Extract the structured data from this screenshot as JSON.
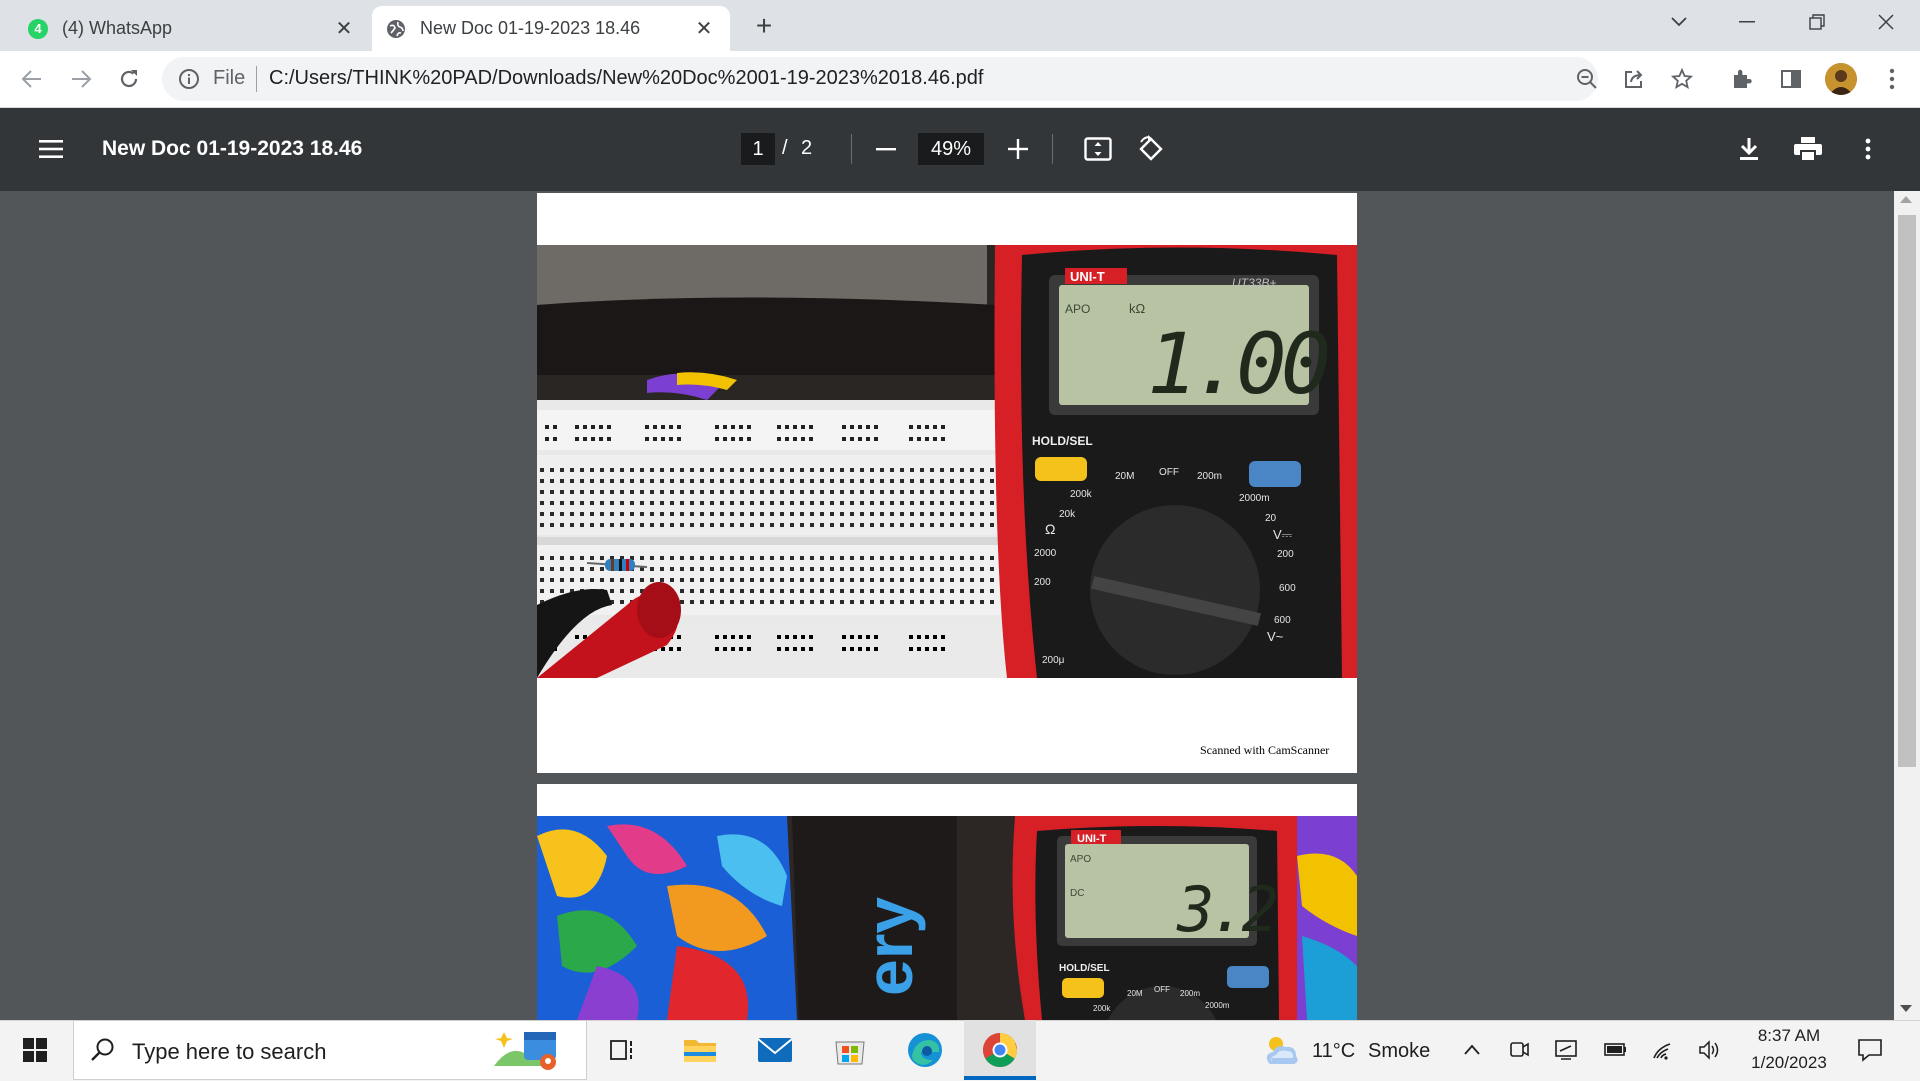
{
  "tabs": [
    {
      "title": "(4) WhatsApp",
      "badge": "4",
      "active": false
    },
    {
      "title": "New Doc 01-19-2023 18.46",
      "active": true
    }
  ],
  "address": {
    "scheme": "File",
    "url": "C:/Users/THINK%20PAD/Downloads/New%20Doc%2001-19-2023%2018.46.pdf"
  },
  "pdf": {
    "title": "New Doc 01-19-2023 18.46",
    "current_page": "1",
    "separator": "/",
    "total_pages": "2",
    "zoom": "49%"
  },
  "page1": {
    "footer": "Scanned with CamScanner",
    "meter": {
      "brand": "UNI-T",
      "model": "UT33B+",
      "apo": "APO",
      "unit": "kΩ",
      "reading": "1.00",
      "hold_label": "HOLD/SEL",
      "dial": [
        "20M",
        "OFF",
        "200m",
        "200k",
        "2000m",
        "20k",
        "20",
        "Ω",
        "V⎓",
        "2000",
        "200",
        "200",
        "600",
        "600",
        "V~",
        "200μ"
      ]
    }
  },
  "page2": {
    "meter": {
      "brand": "UNI-T",
      "apo": "APO",
      "dc": "DC",
      "reading": "3.2",
      "hold_label": "HOLD/SEL",
      "dial": [
        "20M",
        "OFF",
        "200m",
        "200k",
        "2000m"
      ]
    },
    "box_text": "ery"
  },
  "taskbar": {
    "search_placeholder": "Type here to search",
    "weather_temp": "11°C",
    "weather_text": "Smoke",
    "time": "8:37 AM",
    "date": "1/20/2023"
  },
  "colors": {
    "tabstrip": "#dee1e6",
    "pdf_toolbar": "#323639",
    "viewer_bg": "#525659",
    "meter_red": "#d71f26",
    "lcd": "#b7c3a3",
    "whatsapp": "#25d366"
  }
}
